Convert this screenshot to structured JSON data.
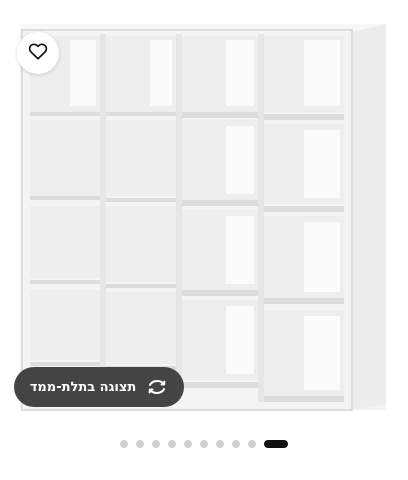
{
  "product": {
    "image_name": "white-cube-shelving-unit",
    "color": "#ffffff"
  },
  "favorite": {
    "icon": "heart-outline-icon"
  },
  "view_3d": {
    "label": "תצוגה בתלת-ממד",
    "icon": "rotate-3d-icon"
  },
  "carousel": {
    "total": 10,
    "active_index": 9
  }
}
